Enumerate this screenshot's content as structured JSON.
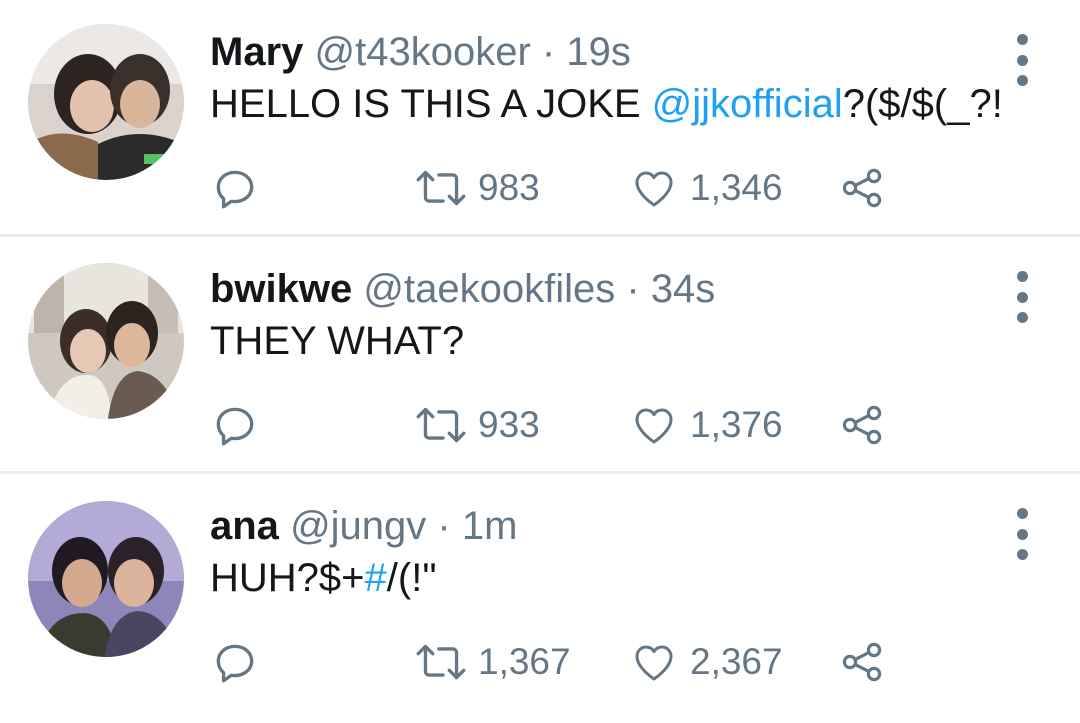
{
  "tweets": [
    {
      "name": "Mary",
      "handle": "@t43kooker",
      "separator": "·",
      "time": "19s",
      "text_prefix": "HELLO IS THIS A JOKE ",
      "mention": "@jjkofficial",
      "text_suffix": "?($/$(_?!",
      "retweets": "983",
      "likes": "1,346",
      "avatar_icon": "avatar-photo"
    },
    {
      "name": "bwikwe",
      "handle": "@taekookfiles",
      "separator": "·",
      "time": "34s",
      "text": "THEY WHAT?",
      "retweets": "933",
      "likes": "1,376",
      "avatar_icon": "avatar-photo"
    },
    {
      "name": "ana",
      "handle": "@jungv",
      "separator": "·",
      "time": "1m",
      "text_prefix": "HUH?$+",
      "hashtag": "#",
      "text_suffix": "/(!\"",
      "retweets": "1,367",
      "likes": "2,367",
      "avatar_icon": "avatar-photo"
    }
  ],
  "icons": {
    "reply": "reply-icon",
    "retweet": "retweet-icon",
    "like": "heart-icon",
    "share": "share-icon",
    "more": "more-vertical-icon"
  },
  "colors": {
    "link": "#1da1f2",
    "secondary": "#657786",
    "divider": "#e6ecf0"
  }
}
